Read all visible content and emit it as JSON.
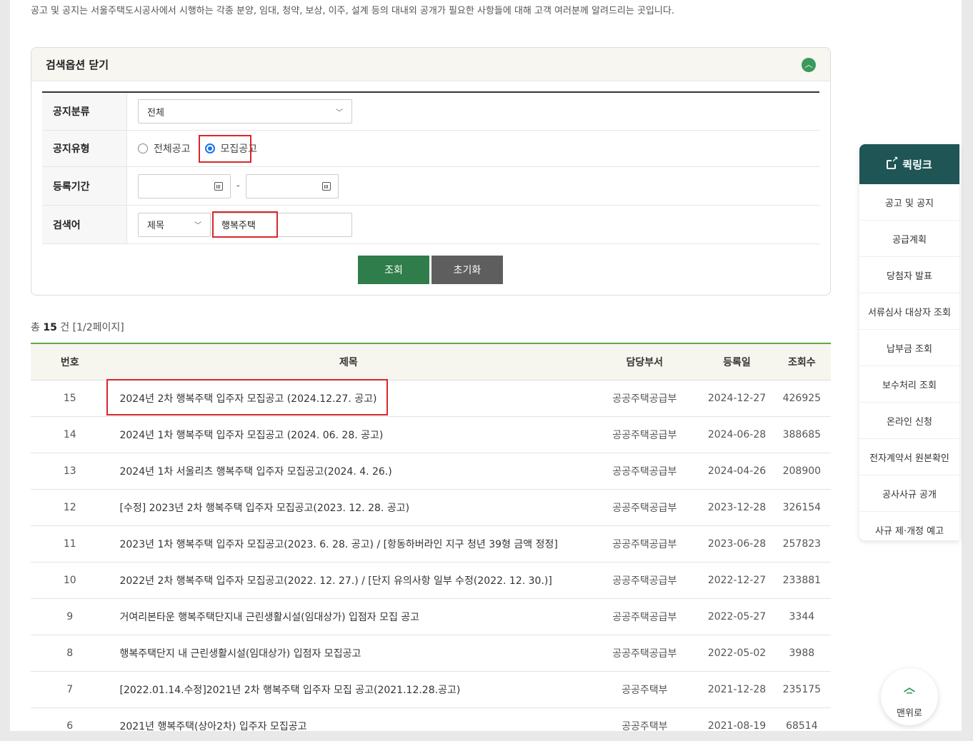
{
  "intro_text": "공고 및 공지는 서울주택도시공사에서 시행하는 각종 분양, 임대, 청약, 보상, 이주, 설계 등의 대내외 공개가 필요한 사항들에 대해 고객 여러분께 알려드리는 곳입니다.",
  "search": {
    "toggle_title": "검색옵션 닫기",
    "category_label": "공지분류",
    "category_value": "전체",
    "type_label": "공지유형",
    "type_all": "전체공고",
    "type_recruit": "모집공고",
    "period_label": "등록기간",
    "period_sep": "-",
    "keyword_label": "검색어",
    "keyword_field": "제목",
    "keyword_value": "행복주택",
    "search_button": "조회",
    "reset_button": "초기화"
  },
  "count": {
    "prefix": "총",
    "total": "15",
    "suffix": "건 [1/2페이지]"
  },
  "table": {
    "headers": [
      "번호",
      "제목",
      "담당부서",
      "등록일",
      "조회수"
    ],
    "rows": [
      {
        "num": "15",
        "title": "2024년 2차 행복주택 입주자 모집공고 (2024.12.27. 공고)",
        "dept": "공공주택공급부",
        "date": "2024-12-27",
        "views": "426925"
      },
      {
        "num": "14",
        "title": "2024년 1차 행복주택 입주자 모집공고 (2024. 06. 28. 공고)",
        "dept": "공공주택공급부",
        "date": "2024-06-28",
        "views": "388685"
      },
      {
        "num": "13",
        "title": "2024년 1차 서울리츠 행복주택 입주자 모집공고(2024. 4. 26.)",
        "dept": "공공주택공급부",
        "date": "2024-04-26",
        "views": "208900"
      },
      {
        "num": "12",
        "title": "[수정] 2023년 2차 행복주택 입주자 모집공고(2023. 12. 28. 공고)",
        "dept": "공공주택공급부",
        "date": "2023-12-28",
        "views": "326154"
      },
      {
        "num": "11",
        "title": "2023년 1차 행복주택 입주자 모집공고(2023. 6. 28. 공고) / [항동하버라인 지구 청년 39형 금액 정정]",
        "dept": "공공주택공급부",
        "date": "2023-06-28",
        "views": "257823"
      },
      {
        "num": "10",
        "title": "2022년 2차 행복주택 입주자 모집공고(2022. 12. 27.) / [단지 유의사항 일부 수정(2022. 12. 30.)]",
        "dept": "공공주택공급부",
        "date": "2022-12-27",
        "views": "233881"
      },
      {
        "num": "9",
        "title": "거여리본타운 행복주택단지내 근린생활시설(임대상가) 입점자 모집 공고",
        "dept": "공공주택공급부",
        "date": "2022-05-27",
        "views": "3344"
      },
      {
        "num": "8",
        "title": "행복주택단지 내 근린생활시설(임대상가) 입점자 모집공고",
        "dept": "공공주택공급부",
        "date": "2022-05-02",
        "views": "3988"
      },
      {
        "num": "7",
        "title": "[2022.01.14.수정]2021년 2차 행복주택 입주자 모집 공고(2021.12.28.공고)",
        "dept": "공공주택부",
        "date": "2021-12-28",
        "views": "235175"
      },
      {
        "num": "6",
        "title": "2021년 행복주택(상아2차) 입주자 모집공고",
        "dept": "공공주택부",
        "date": "2021-08-19",
        "views": "68514"
      }
    ]
  },
  "quick": {
    "title": "퀵링크",
    "items": [
      "공고 및 공지",
      "공급계획",
      "당첨자 발표",
      "서류심사 대상자 조회",
      "납부금 조회",
      "보수처리 조회",
      "온라인 신청",
      "전자계약서 원본확인",
      "공사사규 공개",
      "사규 제·개정 예고"
    ]
  },
  "top_button": "맨위로",
  "colors": {
    "accent_green": "#2e7d4a",
    "quick_header": "#1f5555",
    "highlight_red": "#d9262c"
  }
}
